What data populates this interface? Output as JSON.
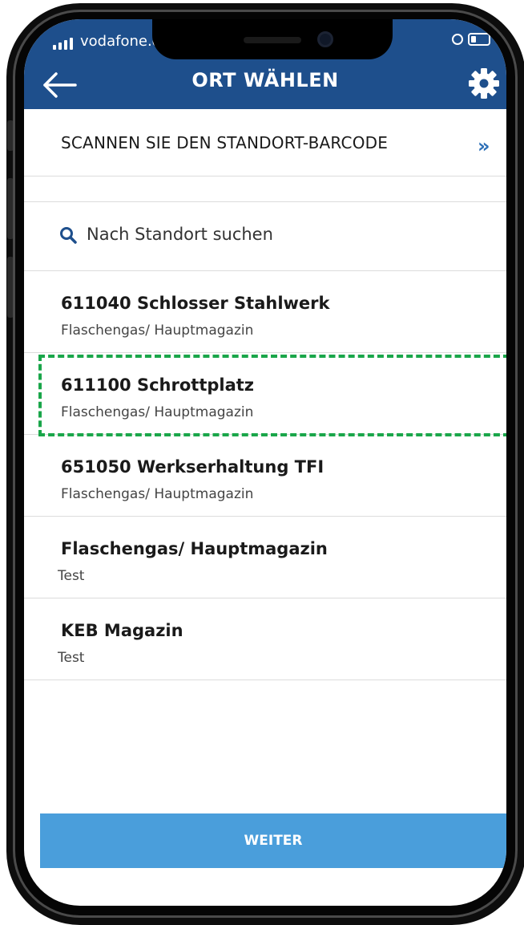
{
  "status_bar": {
    "carrier": "vodafone.de"
  },
  "header": {
    "title": "ORT WÄHLEN",
    "back_icon": "arrow-left-icon",
    "settings_icon": "gear-icon"
  },
  "scan": {
    "label": "SCANNEN SIE DEN STANDORT-BARCODE",
    "chevron": "»"
  },
  "search": {
    "placeholder": "Nach Standort suchen",
    "icon": "search-icon"
  },
  "locations": [
    {
      "name": "611040 Schlosser Stahlwerk",
      "sub": "Flaschengas/ Hauptmagazin",
      "selected": false
    },
    {
      "name": "611100 Schrottplatz",
      "sub": "Flaschengas/ Hauptmagazin",
      "selected": true
    },
    {
      "name": "651050 Werkserhaltung TFI",
      "sub": "Flaschengas/ Hauptmagazin",
      "selected": false
    },
    {
      "name": "Flaschengas/ Hauptmagazin",
      "sub": "Test",
      "selected": false
    },
    {
      "name": "KEB Magazin",
      "sub": "Test",
      "selected": false
    }
  ],
  "footer": {
    "weiter_label": "WEITER"
  },
  "colors": {
    "header_bg": "#1e4f8c",
    "accent": "#2c6fb7",
    "button_bg": "#4a9edb",
    "selection_border": "#1aa64a"
  }
}
